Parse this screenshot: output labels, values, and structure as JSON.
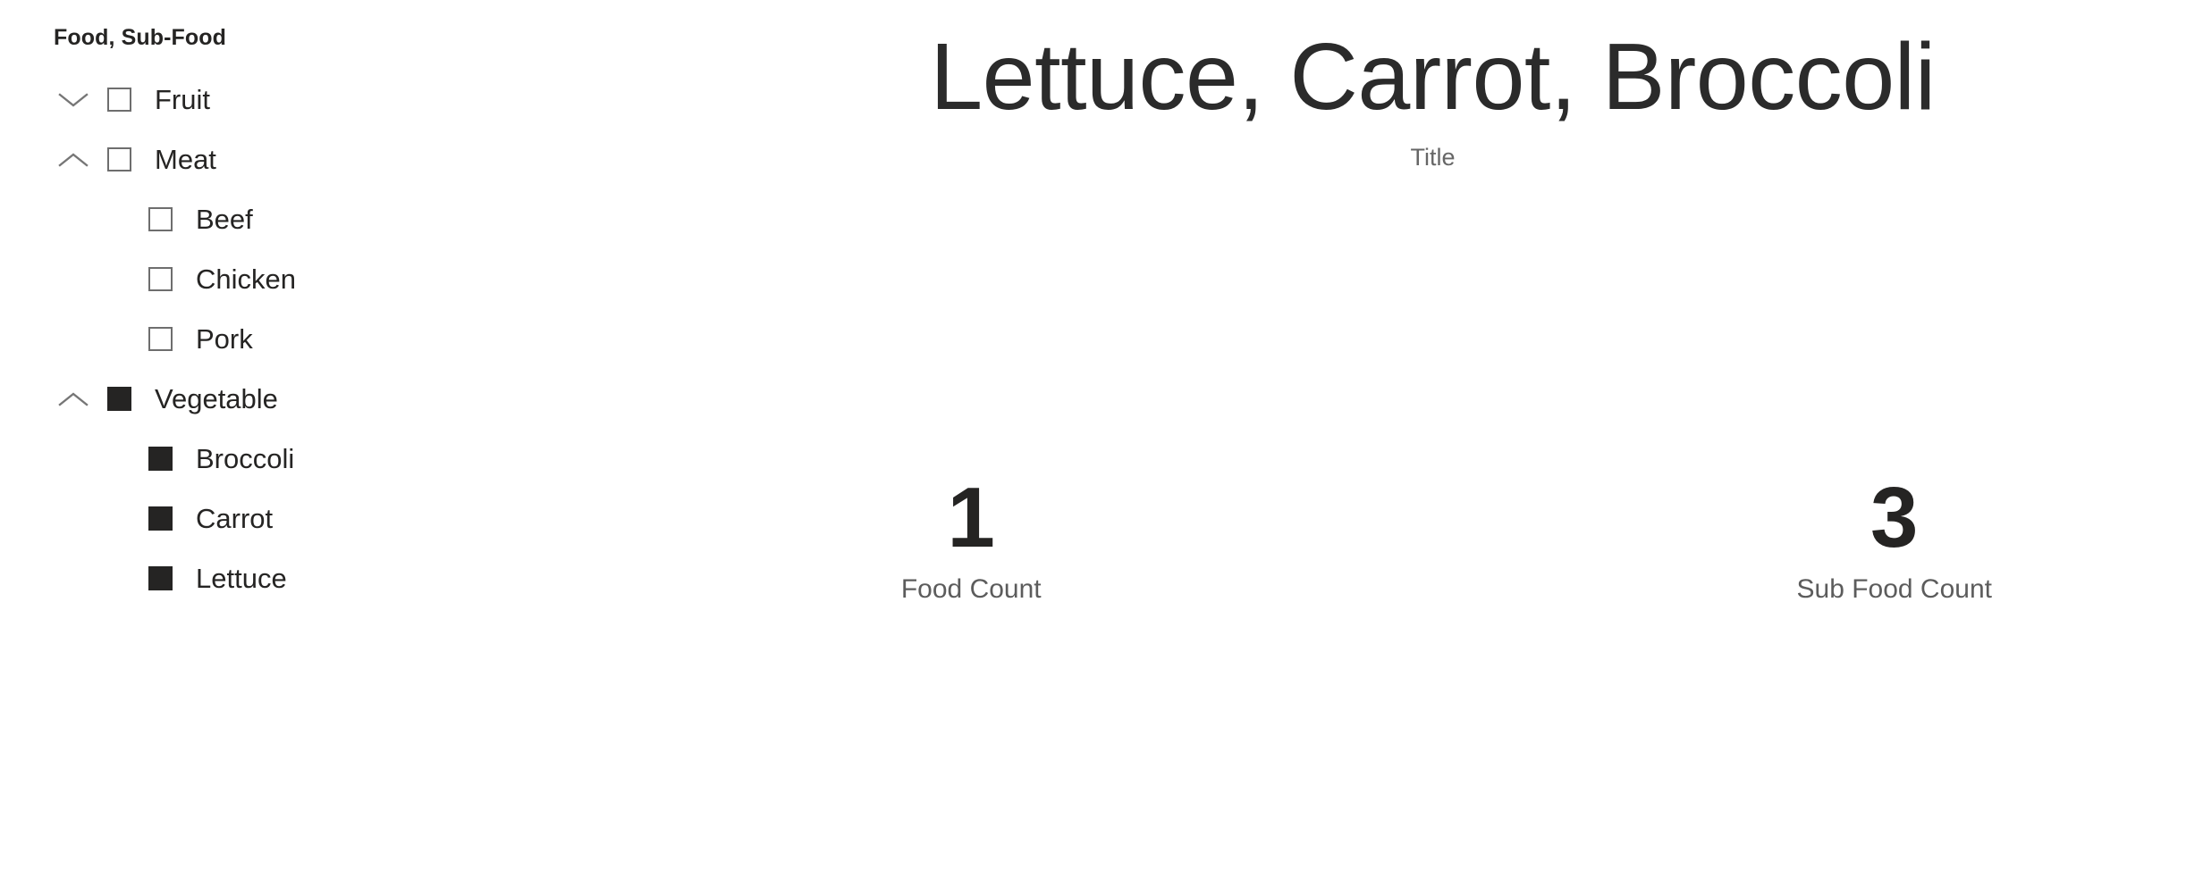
{
  "slicer": {
    "header": "Food, Sub-Food",
    "items": [
      {
        "label": "Fruit",
        "level": 0,
        "checked": false,
        "expandable": true,
        "expanded": false,
        "icon": "chevron-down-icon"
      },
      {
        "label": "Meat",
        "level": 0,
        "checked": false,
        "expandable": true,
        "expanded": true,
        "icon": "chevron-up-icon"
      },
      {
        "label": "Beef",
        "level": 1,
        "checked": false,
        "expandable": false,
        "expanded": false,
        "icon": ""
      },
      {
        "label": "Chicken",
        "level": 1,
        "checked": false,
        "expandable": false,
        "expanded": false,
        "icon": ""
      },
      {
        "label": "Pork",
        "level": 1,
        "checked": false,
        "expandable": false,
        "expanded": false,
        "icon": ""
      },
      {
        "label": "Vegetable",
        "level": 0,
        "checked": true,
        "expandable": true,
        "expanded": true,
        "icon": "chevron-up-icon"
      },
      {
        "label": "Broccoli",
        "level": 1,
        "checked": true,
        "expandable": false,
        "expanded": false,
        "icon": ""
      },
      {
        "label": "Carrot",
        "level": 1,
        "checked": true,
        "expandable": false,
        "expanded": false,
        "icon": ""
      },
      {
        "label": "Lettuce",
        "level": 1,
        "checked": true,
        "expandable": false,
        "expanded": false,
        "icon": ""
      }
    ]
  },
  "report": {
    "title": "Lettuce, Carrot, Broccoli",
    "subtitle": "Title",
    "kpis": [
      {
        "value": "1",
        "label": "Food Count"
      },
      {
        "value": "3",
        "label": "Sub Food Count"
      }
    ]
  },
  "colors": {
    "text_primary": "#252423",
    "text_secondary": "#5c5c5c",
    "checkbox_border": "#6e6e6e",
    "checkbox_fill": "#252423",
    "chevron": "#767676",
    "background": "#ffffff"
  }
}
